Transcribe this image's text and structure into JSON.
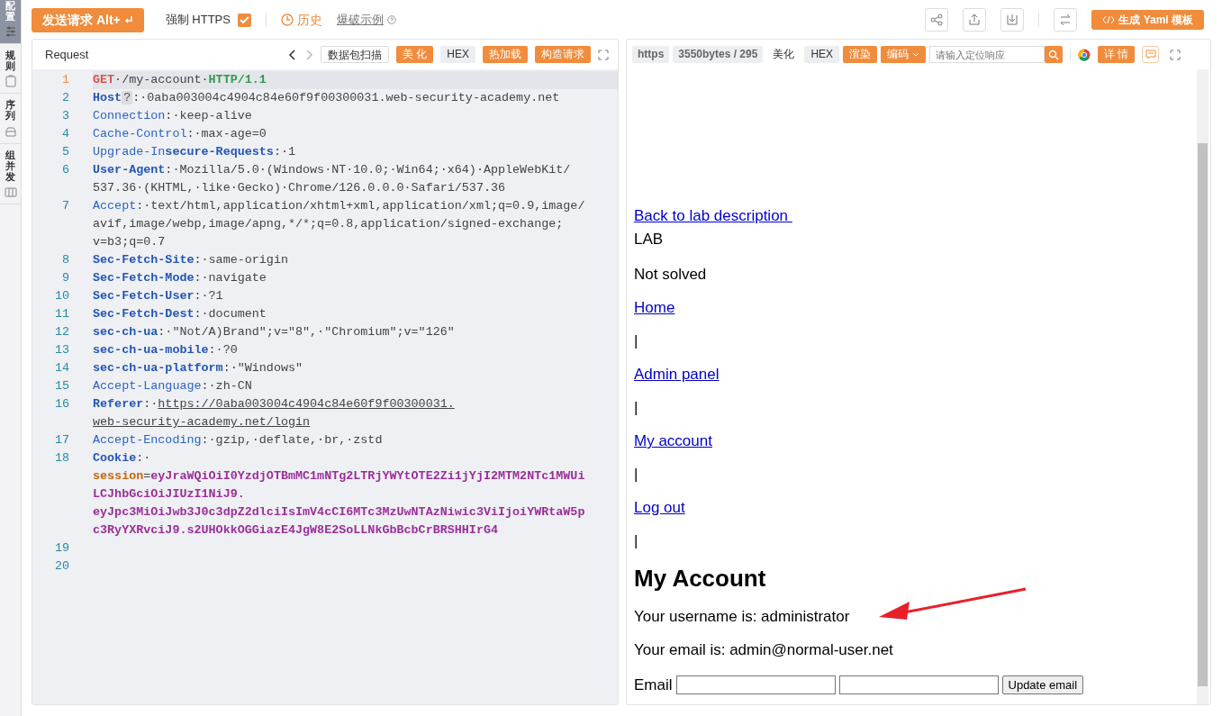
{
  "toolbar": {
    "send_button": "发送请求 Alt+",
    "force_https": {
      "label": "强制 HTTPS",
      "checked": true
    },
    "history": "历史",
    "example_link": "爆破示例",
    "yaml_button": "生成 Yaml 模板"
  },
  "sidebar": {
    "items": [
      {
        "label": "配置",
        "selected": true
      },
      {
        "label": "规则",
        "selected": false
      },
      {
        "label": "序列",
        "selected": false
      },
      {
        "label": "组并发",
        "selected": false
      }
    ]
  },
  "request": {
    "title": "Request",
    "buttons": [
      {
        "label": "数据包扫描",
        "kind": "outline"
      },
      {
        "label": "美 化",
        "kind": "primary"
      },
      {
        "label": "HEX",
        "kind": "plain"
      },
      {
        "label": "热加载",
        "kind": "primary"
      },
      {
        "label": "构造请求",
        "kind": "primary"
      }
    ],
    "lines": [
      {
        "number": "1",
        "current": true,
        "rows": [
          [
            {
              "kind": "method",
              "text": "GET"
            },
            {
              "kind": "value",
              "text": "·/my-account·"
            },
            {
              "kind": "version",
              "text": "HTTP/1.1"
            }
          ]
        ]
      },
      {
        "number": "2",
        "current": false,
        "rows": [
          [
            {
              "kind": "keyb",
              "text": "Host"
            },
            {
              "kind": "chip",
              "text": "?"
            },
            {
              "kind": "value",
              "text": ":·0aba003004c4904c84e60f9f00300031.web-security-academy.net"
            }
          ]
        ]
      },
      {
        "number": "3",
        "current": false,
        "rows": [
          [
            {
              "kind": "key",
              "text": "Connection"
            },
            {
              "kind": "value",
              "text": ":·keep-alive"
            }
          ]
        ]
      },
      {
        "number": "4",
        "current": false,
        "rows": [
          [
            {
              "kind": "key",
              "text": "Cache-Control"
            },
            {
              "kind": "value",
              "text": ":·max-age=0"
            }
          ]
        ]
      },
      {
        "number": "5",
        "current": false,
        "rows": [
          [
            {
              "kind": "key",
              "text": "Upgrade-In"
            },
            {
              "kind": "keyb",
              "text": "secure-Requests"
            },
            {
              "kind": "value",
              "text": ":·1"
            }
          ]
        ]
      },
      {
        "number": "6",
        "current": false,
        "rows": [
          [
            {
              "kind": "keyb",
              "text": "User-Agent"
            },
            {
              "kind": "value",
              "text": ":·Mozilla/5.0·(Windows·NT·10.0;·Win64;·x64)·AppleWebKit/"
            }
          ],
          [
            {
              "kind": "value",
              "text": "537.36·(KHTML,·like·Gecko)·Chrome/126.0.0.0·Safari/537.36"
            }
          ]
        ]
      },
      {
        "number": "7",
        "current": false,
        "rows": [
          [
            {
              "kind": "key",
              "text": "Accept"
            },
            {
              "kind": "value",
              "text": ":·text/html,application/xhtml+xml,application/xml;q=0.9,image/"
            }
          ],
          [
            {
              "kind": "value",
              "text": "avif,image/webp,image/apng,*/*;q=0.8,application/signed-exchange;"
            }
          ],
          [
            {
              "kind": "value",
              "text": "v=b3;q=0.7"
            }
          ]
        ]
      },
      {
        "number": "8",
        "current": false,
        "rows": [
          [
            {
              "kind": "keyb",
              "text": "Sec-Fetch-Site"
            },
            {
              "kind": "value",
              "text": ":·same-origin"
            }
          ]
        ]
      },
      {
        "number": "9",
        "current": false,
        "rows": [
          [
            {
              "kind": "keyb",
              "text": "Sec-Fetch-Mode"
            },
            {
              "kind": "value",
              "text": ":·navigate"
            }
          ]
        ]
      },
      {
        "number": "10",
        "current": false,
        "rows": [
          [
            {
              "kind": "keyb",
              "text": "Sec-Fetch-User"
            },
            {
              "kind": "value",
              "text": ":·?1"
            }
          ]
        ]
      },
      {
        "number": "11",
        "current": false,
        "rows": [
          [
            {
              "kind": "keyb",
              "text": "Sec-Fetch-Dest"
            },
            {
              "kind": "value",
              "text": ":·document"
            }
          ]
        ]
      },
      {
        "number": "12",
        "current": false,
        "rows": [
          [
            {
              "kind": "keyb",
              "text": "sec-ch-ua"
            },
            {
              "kind": "value",
              "text": ":·\"Not/A)Brand\";v=\"8\",·\"Chromium\";v=\"126\""
            }
          ]
        ]
      },
      {
        "number": "13",
        "current": false,
        "rows": [
          [
            {
              "kind": "keyb",
              "text": "sec-ch-ua-mobile"
            },
            {
              "kind": "value",
              "text": ":·?0"
            }
          ]
        ]
      },
      {
        "number": "14",
        "current": false,
        "rows": [
          [
            {
              "kind": "keyb",
              "text": "sec-ch-ua-platform"
            },
            {
              "kind": "value",
              "text": ":·\"Windows\""
            }
          ]
        ]
      },
      {
        "number": "15",
        "current": false,
        "rows": [
          [
            {
              "kind": "key",
              "text": "Accept-Language"
            },
            {
              "kind": "value",
              "text": ":·zh-CN"
            }
          ]
        ]
      },
      {
        "number": "16",
        "current": false,
        "rows": [
          [
            {
              "kind": "keyb",
              "text": "Referer"
            },
            {
              "kind": "value",
              "text": ":·"
            },
            {
              "kind": "url",
              "text": "https://0aba003004c4904c84e60f9f00300031."
            }
          ],
          [
            {
              "kind": "url",
              "text": "web-security-academy.net/login"
            }
          ]
        ]
      },
      {
        "number": "17",
        "current": false,
        "rows": [
          [
            {
              "kind": "key",
              "text": "Accept-Encoding"
            },
            {
              "kind": "value",
              "text": ":·gzip,·deflate,·br,·zstd"
            }
          ]
        ]
      },
      {
        "number": "18",
        "current": false,
        "rows": [
          [
            {
              "kind": "keyb",
              "text": "Cookie"
            },
            {
              "kind": "value",
              "text": ":·"
            }
          ],
          [
            {
              "kind": "cname",
              "text": "session"
            },
            {
              "kind": "value",
              "text": "="
            },
            {
              "kind": "cval",
              "text": "eyJraWQiOiI0YzdjOTBmMC1mNTg2LTRjYWYtOTE2Zi1jYjI2MTM2NTc1MWUi"
            }
          ],
          [
            {
              "kind": "cval",
              "text": "LCJhbGciOiJIUzI1NiJ9."
            }
          ],
          [
            {
              "kind": "cval",
              "text": "eyJpc3MiOiJwb3J0c3dpZ2dlciIsImV4cCI6MTc3MzUwNTAzNiwic3ViIjoiYWRtaW5p"
            }
          ],
          [
            {
              "kind": "cval",
              "text": "c3RyYXRvciJ9.s2UHOkkOGGiazE4JgW8E2SoLLNkGbBcbCrBRSHHIrG4"
            }
          ]
        ]
      },
      {
        "number": "19",
        "current": false,
        "rows": [
          []
        ]
      },
      {
        "number": "20",
        "current": false,
        "rows": [
          []
        ]
      }
    ]
  },
  "response": {
    "toolbar": {
      "scheme": "https",
      "size": "3550bytes / 295",
      "beautify": "美化",
      "hex": "HEX",
      "render": "渲染",
      "encode": "编码",
      "search_placeholder": "请输入定位响应",
      "details": "详 情"
    },
    "blocks": [
      {
        "kind": "link",
        "text": "Back to lab description "
      },
      {
        "kind": "text",
        "text": "LAB"
      },
      {
        "kind": "para",
        "text": "Not solved"
      },
      {
        "kind": "plink",
        "text": "Home"
      },
      {
        "kind": "para",
        "text": "|"
      },
      {
        "kind": "plink",
        "text": "Admin panel"
      },
      {
        "kind": "para",
        "text": "|"
      },
      {
        "kind": "plink",
        "text": "My account"
      },
      {
        "kind": "para",
        "text": "|"
      },
      {
        "kind": "plink",
        "text": "Log out"
      },
      {
        "kind": "para",
        "text": "|"
      },
      {
        "kind": "heading",
        "text": "My Account"
      },
      {
        "kind": "para",
        "text": "Your username is: administrator"
      },
      {
        "kind": "para",
        "text": "Your email is: admin@normal-user.net"
      },
      {
        "kind": "form",
        "label": "Email",
        "button": "Update email"
      }
    ]
  }
}
